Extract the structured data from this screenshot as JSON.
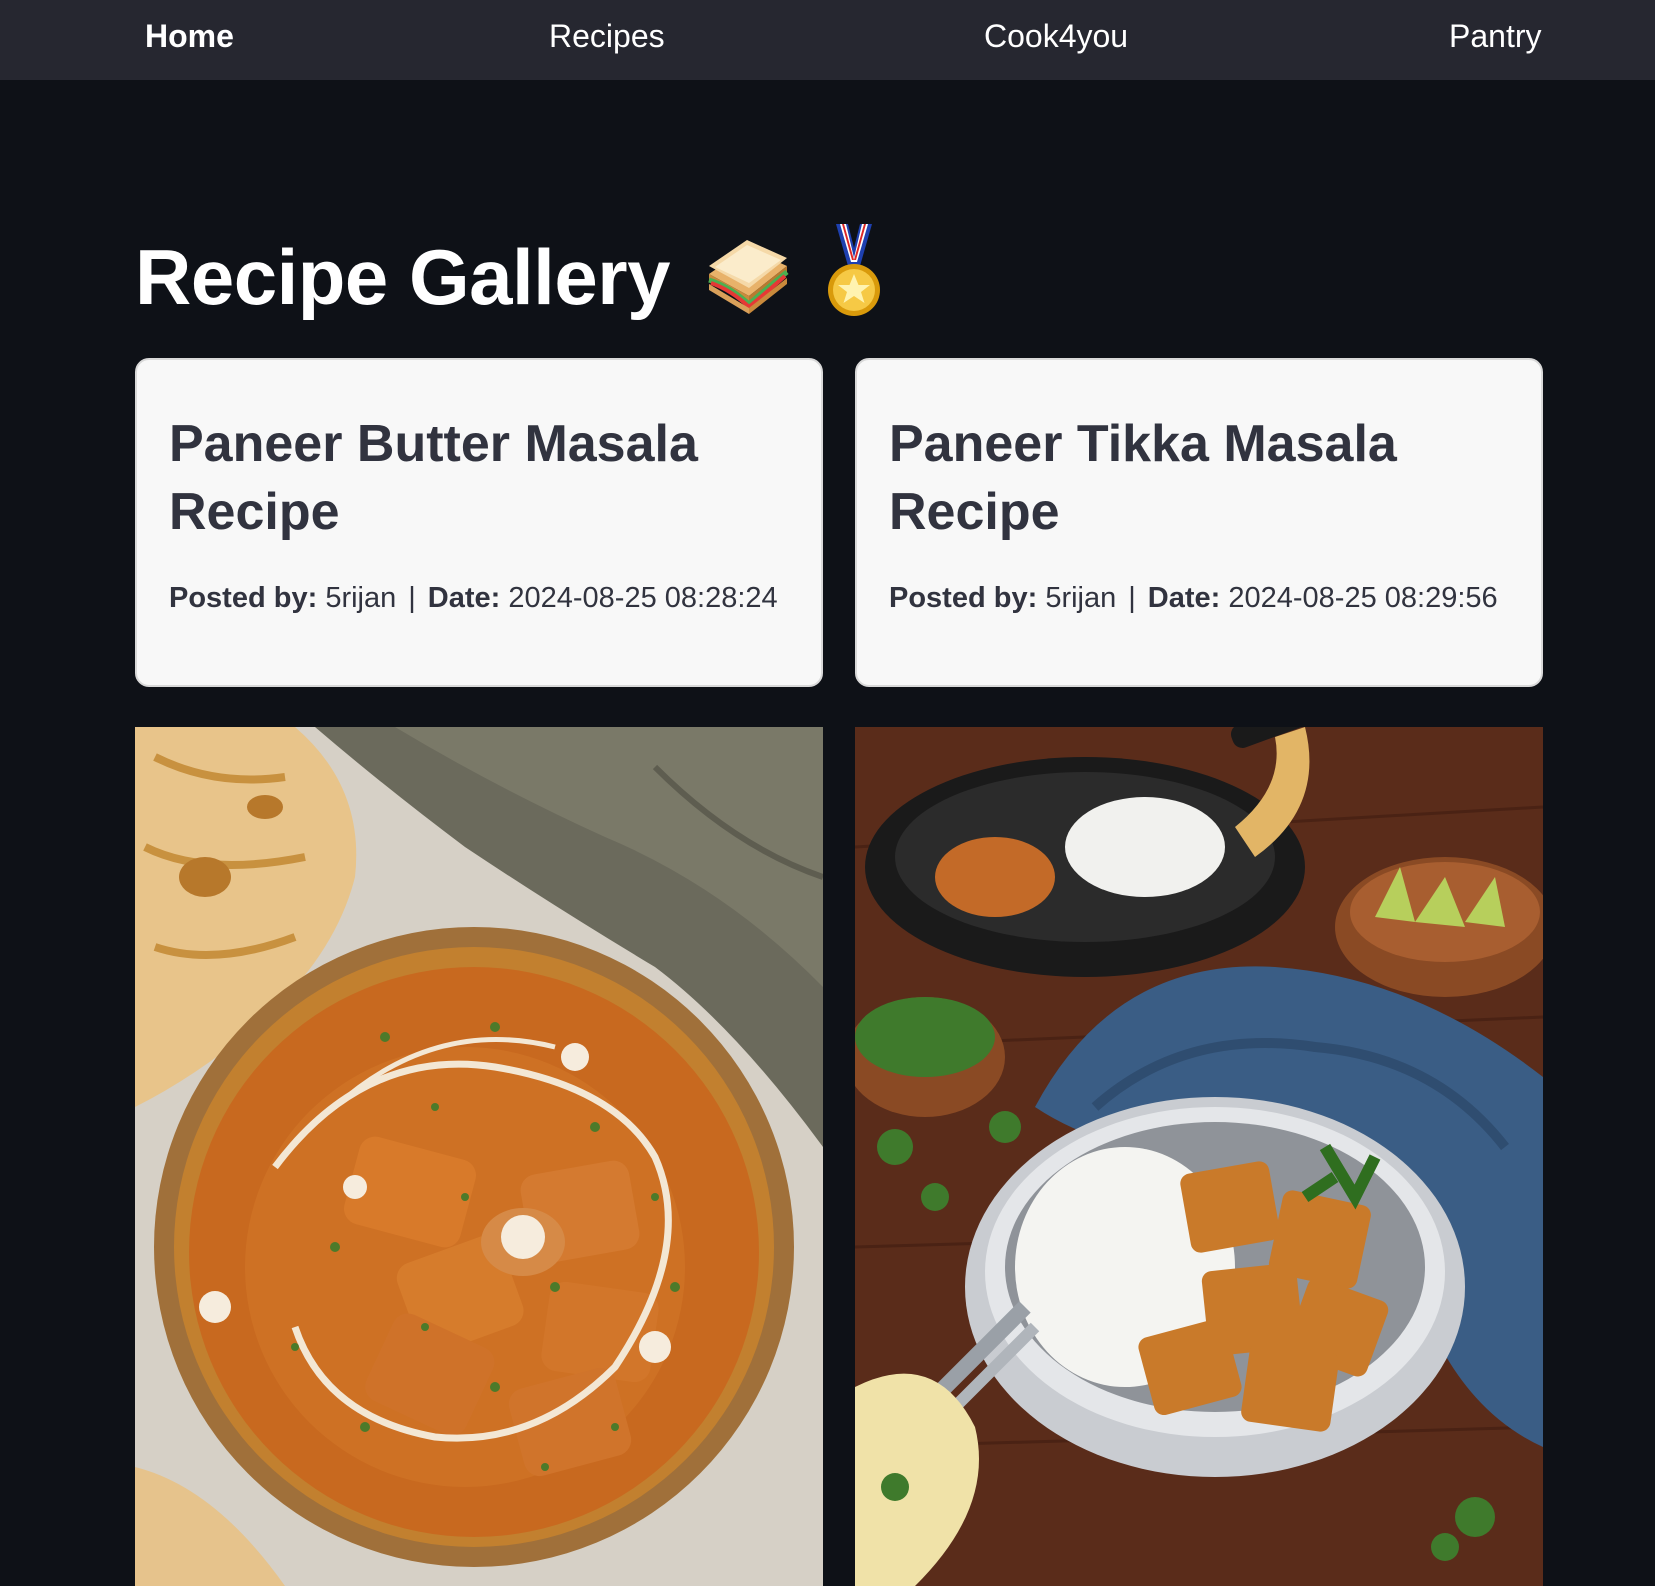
{
  "nav": {
    "home": "Home",
    "recipes": "Recipes",
    "cook4you": "Cook4you",
    "pantry": "Pantry"
  },
  "page": {
    "title": "Recipe Gallery"
  },
  "meta_labels": {
    "posted_by": "Posted by:",
    "separator": "|",
    "date": "Date:"
  },
  "recipes": [
    {
      "title": "Paneer Butter Masala Recipe",
      "author": "5rijan",
      "date": "2024-08-25 08:28:24"
    },
    {
      "title": "Paneer Tikka Masala Recipe",
      "author": "5rijan",
      "date": "2024-08-25 08:29:56"
    }
  ],
  "colors": {
    "background": "#0e1117",
    "navbar": "#262730",
    "card": "#f8f8f8",
    "card_text": "#31333f"
  },
  "icons": [
    "sandwich-icon",
    "medal-icon"
  ]
}
